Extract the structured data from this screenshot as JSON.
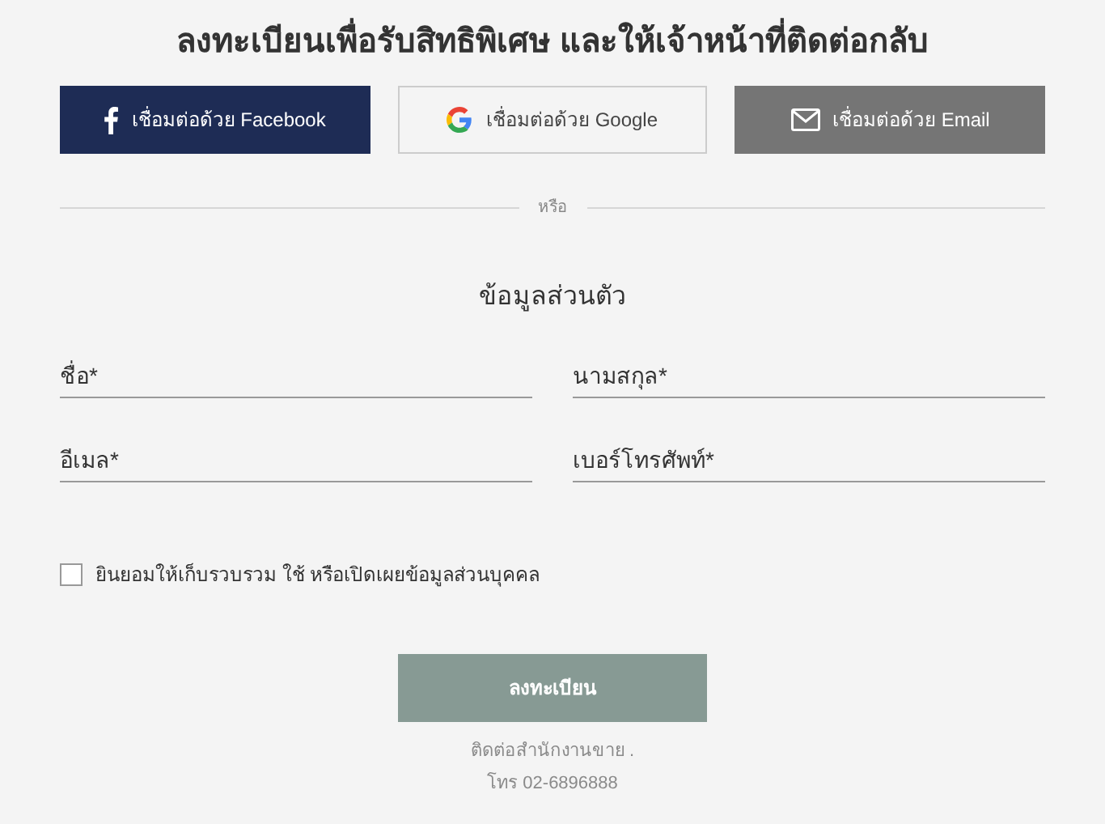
{
  "title": "ลงทะเบียนเพื่อรับสิทธิพิเศษ และให้เจ้าหน้าที่ติดต่อกลับ",
  "social_buttons": [
    {
      "kind": "facebook",
      "label": "เชื่อมต่อด้วย Facebook"
    },
    {
      "kind": "google",
      "label": "เชื่อมต่อด้วย Google"
    },
    {
      "kind": "email",
      "label": "เชื่อมต่อด้วย Email"
    }
  ],
  "divider_text": "หรือ",
  "section_title": "ข้อมูลส่วนตัว",
  "fields": [
    {
      "placeholder": "ชื่อ*"
    },
    {
      "placeholder": "นามสกุล*"
    },
    {
      "placeholder": "อีเมล*"
    },
    {
      "placeholder": "เบอร์โทรศัพท์*"
    }
  ],
  "consent": {
    "label": "ยินยอมให้เก็บรวบรวม ใช้ หรือเปิดเผยข้อมูลส่วนบุคคล",
    "checked": false
  },
  "submit_button": "ลงทะเบียน",
  "contact": [
    "ติดต่อสำนักงานขาย .",
    "โทร 02-6896888"
  ]
}
